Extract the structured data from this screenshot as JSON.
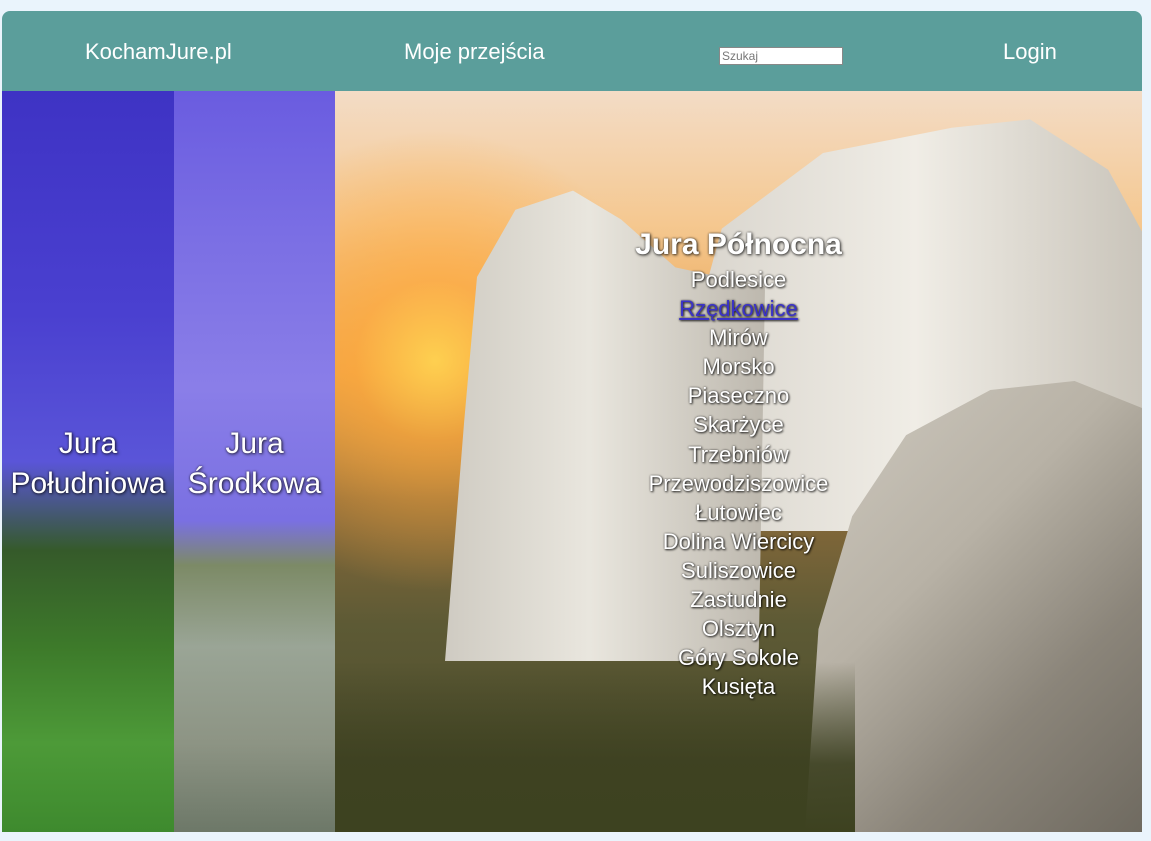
{
  "header": {
    "brand": "KochamJure.pl",
    "my_climbs": "Moje przejścia",
    "search_placeholder": "Szukaj",
    "login": "Login"
  },
  "regions": {
    "south": {
      "label_line1": "Jura",
      "label_line2": "Południowa"
    },
    "central": {
      "label_line1": "Jura",
      "label_line2": "Środkowa"
    },
    "north": {
      "title": "Jura Północna",
      "areas": [
        "Podlesice",
        "Rzędkowice",
        "Mirów",
        "Morsko",
        "Piaseczno",
        "Skarżyce",
        "Trzebniów",
        "Przewodziszowice",
        "Łutowiec",
        "Dolina Wiercicy",
        "Suliszowice",
        "Zastudnie",
        "Olsztyn",
        "Góry Sokole",
        "Kusięta"
      ],
      "highlighted_area": "Rzędkowice"
    }
  },
  "colors": {
    "header_bg": "#5b9e9b",
    "page_bg": "#eaf4fc",
    "link_highlight": "#3a32c8"
  }
}
